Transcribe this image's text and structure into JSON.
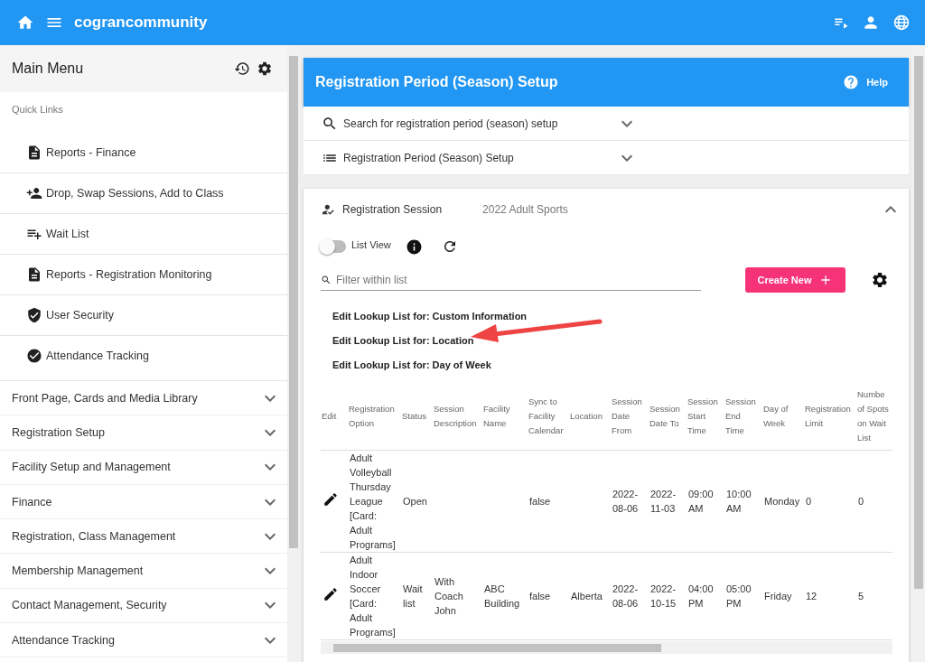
{
  "app_bar": {
    "title": "cograncommunity"
  },
  "sidebar": {
    "title": "Main Menu",
    "quick_links_label": "Quick Links",
    "quick_links": [
      {
        "label": "Reports - Finance",
        "kind": "report"
      },
      {
        "label": "Drop, Swap Sessions, Add to Class",
        "kind": "person-add"
      },
      {
        "label": "Wait List",
        "kind": "list-add"
      },
      {
        "label": "Reports - Registration Monitoring",
        "kind": "report"
      },
      {
        "label": "User Security",
        "kind": "shield"
      },
      {
        "label": "Attendance Tracking",
        "kind": "check"
      }
    ],
    "sections": [
      {
        "label": "Front Page, Cards and Media Library",
        "expanded": false
      },
      {
        "label": "Registration Setup",
        "expanded": false
      },
      {
        "label": "Facility Setup and Management",
        "expanded": false
      },
      {
        "label": "Finance",
        "expanded": false
      },
      {
        "label": "Registration, Class Management",
        "expanded": false
      },
      {
        "label": "Membership Management",
        "expanded": false
      },
      {
        "label": "Contact Management, Security",
        "expanded": false
      },
      {
        "label": "Attendance Tracking",
        "expanded": false
      }
    ]
  },
  "main": {
    "title": "Registration Period (Season) Setup",
    "help": "Help",
    "accordions": [
      {
        "label": "Search for registration period (season) setup",
        "kind": "search",
        "expanded": false
      },
      {
        "label": "Registration Period (Season) Setup",
        "kind": "list",
        "expanded": false
      }
    ],
    "session": {
      "label": "Registration Session",
      "value": "2022 Adult Sports",
      "expanded": true,
      "list_view": {
        "label": "List View",
        "on": false
      },
      "filter": {
        "placeholder": "Filter within list"
      },
      "create_button": "Create New",
      "lookup_links": [
        "Edit Lookup List for: Custom Information",
        "Edit Lookup List for: Location",
        "Edit Lookup List for: Day of Week"
      ],
      "table": {
        "columns": [
          "Edit",
          "Registration Option",
          "Status",
          "Session Description",
          "Facility Name",
          "Sync to Facility Calendar",
          "Location",
          "Session Date From",
          "Session Date To",
          "Session Start Time",
          "Session End Time",
          "Day of Week",
          "Registration Limit",
          "Numbe of Spots on Wait List"
        ],
        "rows": [
          {
            "cells": [
              "",
              "Adult Volleyball Thursday League [Card: Adult Programs]",
              "Open",
              "",
              "",
              "false",
              "",
              "2022-08-06",
              "2022-11-03",
              "09:00 AM",
              "10:00 AM",
              "Monday",
              "0",
              "0"
            ]
          },
          {
            "cells": [
              "",
              "Adult Indoor Soccer [Card: Adult Programs]",
              "Wait list",
              "With Coach John",
              "ABC Building",
              "false",
              "Alberta",
              "2022-08-06",
              "2022-10-15",
              "04:00 PM",
              "05:00 PM",
              "Friday",
              "12",
              "5"
            ]
          }
        ]
      }
    }
  }
}
